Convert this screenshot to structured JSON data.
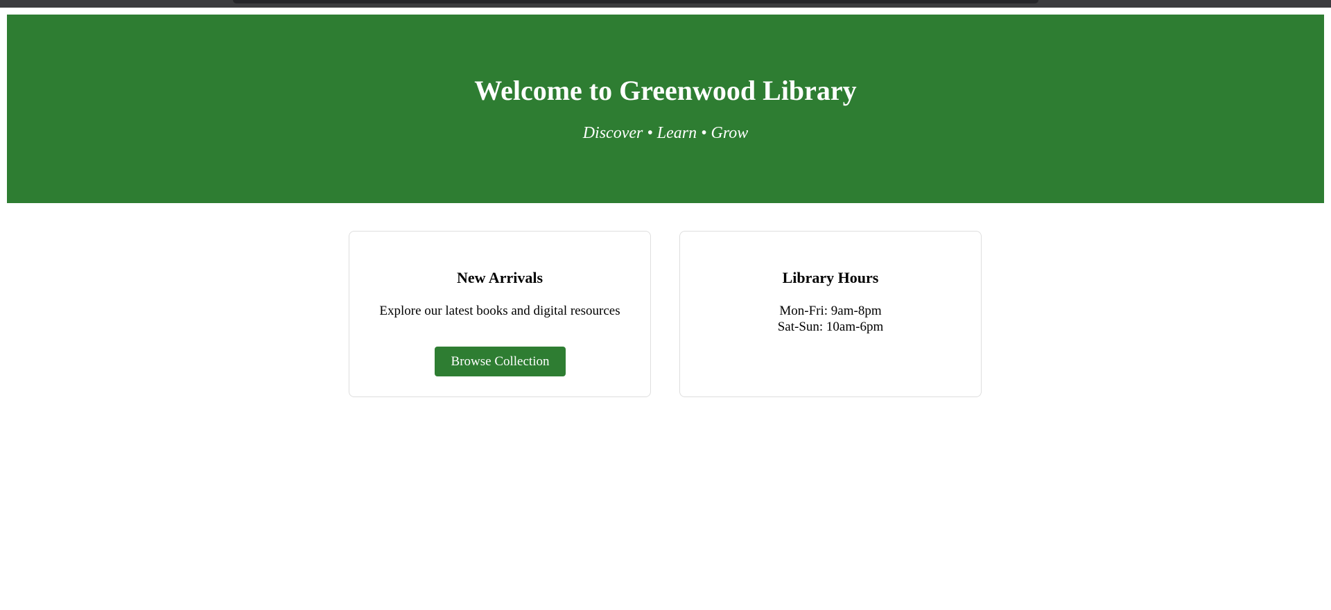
{
  "hero": {
    "title": "Welcome to Greenwood Library",
    "subtitle": "Discover • Learn • Grow",
    "background_color": "#2e7d32"
  },
  "cards": {
    "new_arrivals": {
      "title": "New Arrivals",
      "description": "Explore our latest books and digital resources",
      "button_label": "Browse Collection"
    },
    "hours": {
      "title": "Library Hours",
      "lines": [
        "Mon-Fri: 9am-8pm",
        "Sat-Sun: 10am-6pm"
      ]
    }
  },
  "colors": {
    "accent": "#2e7d32",
    "card_border": "#dedede",
    "browser_bar": "#3c3c3f"
  }
}
